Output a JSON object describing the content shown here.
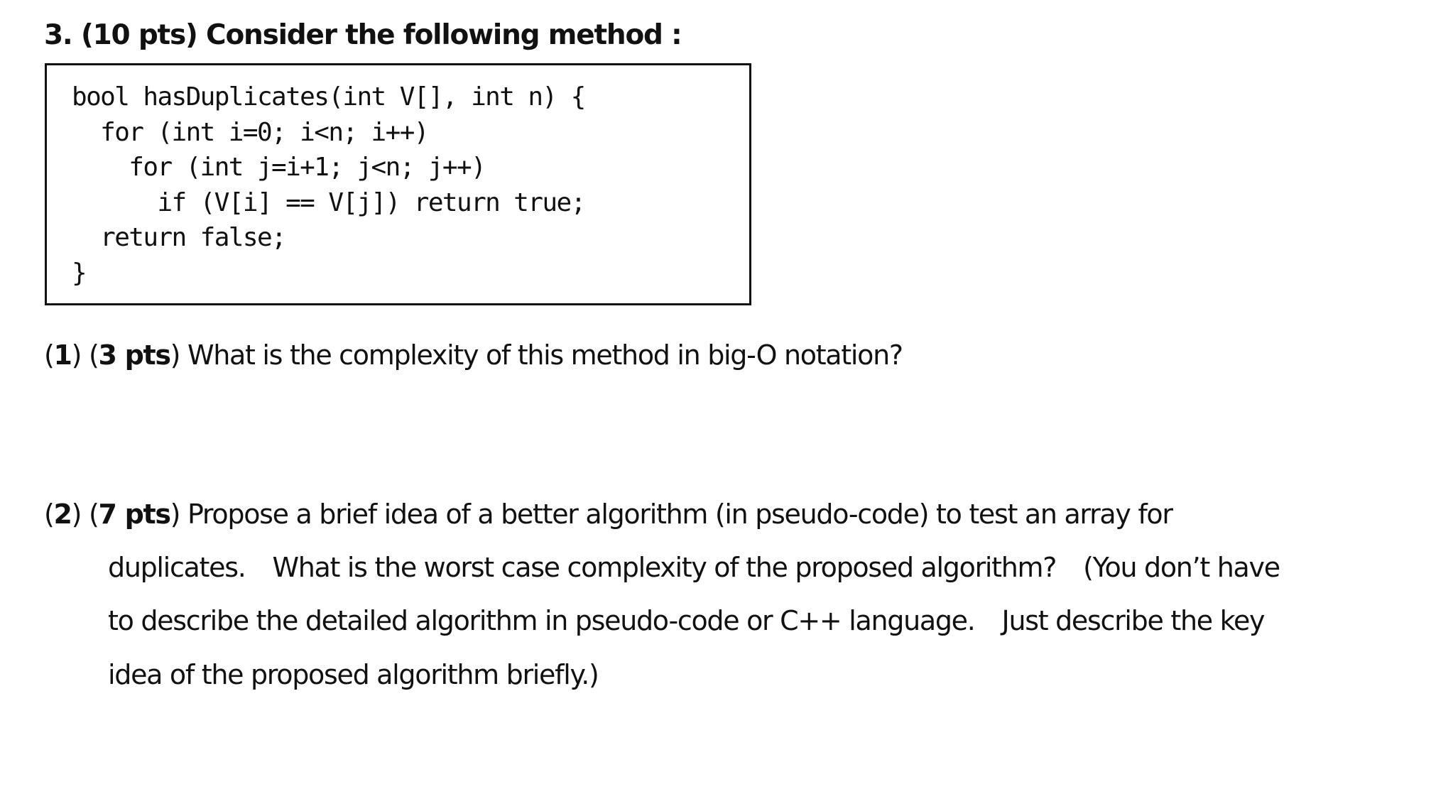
{
  "problem": {
    "number": "3.",
    "points": "(10 pts)",
    "heading": "Consider the following method :"
  },
  "code": {
    "language": "C++",
    "lines": [
      "bool hasDuplicates(int V[], int n) {",
      "  for (int i=0; i<n; i++)",
      "    for (int j=i+1; j<n; j++)",
      "      if (V[i] == V[j]) return true;",
      "  return false;",
      "}"
    ]
  },
  "questions": [
    {
      "label_open": "(",
      "label_num": "1",
      "label_close": ")",
      "pts_open": "(",
      "pts": "3 pts",
      "pts_close": ")",
      "text": "What is the complexity of this method in big-O notation?"
    },
    {
      "label_open": "(",
      "label_num": "2",
      "label_close": ")",
      "pts_open": "(",
      "pts": "7 pts",
      "pts_close": ")",
      "text_lines": [
        "Propose a brief idea of a better algorithm (in pseudo-code) to test an array for",
        "duplicates.",
        "What is the worst case complexity of the proposed algorithm?",
        "(You don’t have",
        "to describe the detailed algorithm in pseudo-code or C++ language.",
        "Just describe the key",
        "idea of the proposed algorithm briefly.)"
      ]
    }
  ]
}
